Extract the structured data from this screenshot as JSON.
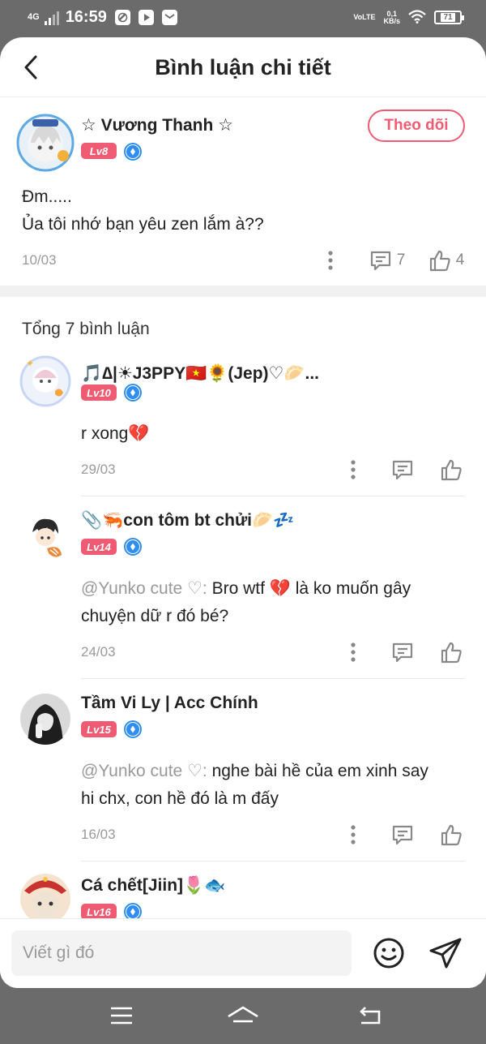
{
  "status_bar": {
    "network": "4G",
    "time": "16:59",
    "volte": "VoLTE",
    "speed_value": "0,1",
    "speed_unit": "KB/s",
    "battery": "71"
  },
  "header": {
    "title": "Bình luận chi tiết"
  },
  "main_comment": {
    "author": "☆ Vương Thanh ☆",
    "level": "Lv8",
    "follow_label": "Theo dõi",
    "text_line1": "Đm.....",
    "text_line2": "Ủa tôi nhớ bạn yêu zen lắm à??",
    "date": "10/03",
    "reply_count": "7",
    "like_count": "4"
  },
  "replies_header": "Tổng 7 bình luận",
  "replies": [
    {
      "author": "🎵∆|☀J3PPY🇻🇳🌻(Jep)♡🥟...",
      "level": "Lv10",
      "mention": "",
      "text": "r xong💔",
      "text2": "",
      "date": "29/03"
    },
    {
      "author": "📎🦐con tôm bt chửi🥟💤",
      "level": "Lv14",
      "mention": "@Yunko cute ♡:",
      "text": " Bro wtf 💔 là ko muốn gây",
      "text2": "chuyện dữ r đó bé?",
      "date": "24/03"
    },
    {
      "author": "Tầm Vi Ly | Acc Chính",
      "level": "Lv15",
      "mention": "@Yunko cute ♡:",
      "text": " nghe bài hề của em xinh say",
      "text2": "hi chx, con hề đó là m đấy",
      "date": "16/03"
    },
    {
      "author": "Cá chết[Jiin]🌷🐟",
      "level": "Lv16"
    }
  ],
  "composer": {
    "placeholder": "Viết gì đó"
  },
  "colors": {
    "accent": "#ef5b72",
    "badge_blue": "#2f8ef0",
    "system_bar": "#6b6b6b"
  }
}
